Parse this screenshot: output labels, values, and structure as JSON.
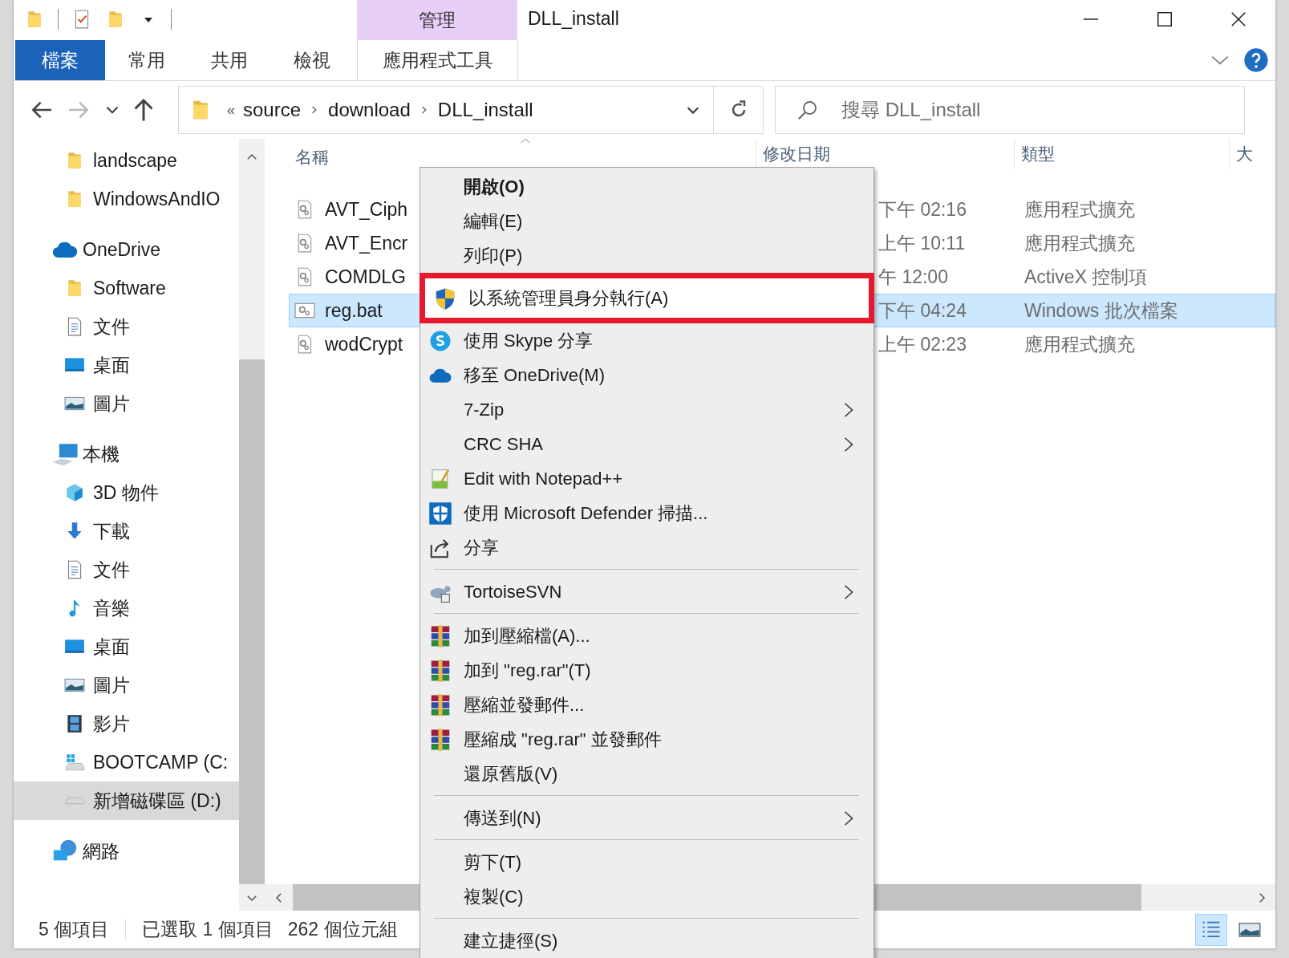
{
  "title_bar": {
    "context_group": "管理",
    "title": "DLL_install"
  },
  "ribbon": {
    "tabs": [
      {
        "label": "檔案",
        "kind": "file"
      },
      {
        "label": "常用",
        "kind": "normal"
      },
      {
        "label": "共用",
        "kind": "normal"
      },
      {
        "label": "檢視",
        "kind": "normal"
      },
      {
        "label": "應用程式工具",
        "kind": "contextual"
      }
    ]
  },
  "address_bar": {
    "overflow_mark": "«",
    "crumbs": [
      "source",
      "download",
      "DLL_install"
    ]
  },
  "search": {
    "placeholder": "搜尋 DLL_install"
  },
  "nav": {
    "sections": [
      {
        "children": [
          {
            "label": "landscape",
            "kind": "folder",
            "selected": false
          },
          {
            "label": "WindowsAndIO",
            "kind": "folder",
            "selected": false
          }
        ]
      },
      {
        "label": "OneDrive",
        "kind": "cloud",
        "selected": false,
        "children": [
          {
            "label": "Software",
            "kind": "folder",
            "selected": false
          },
          {
            "label": "文件",
            "kind": "document",
            "selected": false
          },
          {
            "label": "桌面",
            "kind": "desktop",
            "selected": false
          },
          {
            "label": "圖片",
            "kind": "pictures",
            "selected": false
          }
        ]
      },
      {
        "label": "本機",
        "kind": "computer",
        "selected": false,
        "children": [
          {
            "label": "3D 物件",
            "kind": "cube",
            "selected": false
          },
          {
            "label": "下載",
            "kind": "download",
            "selected": false
          },
          {
            "label": "文件",
            "kind": "document",
            "selected": false
          },
          {
            "label": "音樂",
            "kind": "music",
            "selected": false
          },
          {
            "label": "桌面",
            "kind": "desktop",
            "selected": false
          },
          {
            "label": "圖片",
            "kind": "pictures",
            "selected": false
          },
          {
            "label": "影片",
            "kind": "video",
            "selected": false
          },
          {
            "label": "BOOTCAMP (C:",
            "kind": "windows-drive",
            "selected": false
          },
          {
            "label": "新增磁碟區 (D:)",
            "kind": "drive",
            "selected": true
          }
        ]
      },
      {
        "label": "網路",
        "kind": "network",
        "selected": false
      }
    ]
  },
  "file_list": {
    "columns": [
      "名稱",
      "修改日期",
      "類型",
      "大"
    ],
    "rows": [
      {
        "name": "AVT_Ciph",
        "kind": "library",
        "modified": "下午 02:16",
        "type": "應用程式擴充",
        "selected": false
      },
      {
        "name": "AVT_Encr",
        "kind": "library",
        "modified": "上午 10:11",
        "type": "應用程式擴充",
        "selected": false
      },
      {
        "name": "COMDLG",
        "kind": "library",
        "modified": "午 12:00",
        "type": "ActiveX 控制項",
        "selected": false
      },
      {
        "name": "reg.bat",
        "kind": "batch",
        "modified": "下午 04:24",
        "type": "Windows 批次檔案",
        "selected": true
      },
      {
        "name": "wodCrypt",
        "kind": "library",
        "modified": "上午 02:23",
        "type": "應用程式擴充",
        "selected": false
      }
    ]
  },
  "context_menu": {
    "items": [
      {
        "kind": "plain",
        "label": "開啟(O)",
        "bold": true,
        "submenu": false,
        "highlighted": false
      },
      {
        "kind": "plain",
        "label": "編輯(E)",
        "bold": false,
        "submenu": false,
        "highlighted": false
      },
      {
        "kind": "plain",
        "label": "列印(P)",
        "bold": false,
        "submenu": false,
        "highlighted": false
      },
      {
        "kind": "shield",
        "label": "以系統管理員身分執行(A)",
        "bold": false,
        "submenu": false,
        "highlighted": true
      },
      {
        "kind": "skype",
        "label": "使用 Skype 分享",
        "bold": false,
        "submenu": false,
        "highlighted": false
      },
      {
        "kind": "cloud",
        "label": "移至 OneDrive(M)",
        "bold": false,
        "submenu": false,
        "highlighted": false
      },
      {
        "kind": "plain",
        "label": "7-Zip",
        "bold": false,
        "submenu": true,
        "highlighted": false
      },
      {
        "kind": "plain",
        "label": "CRC SHA",
        "bold": false,
        "submenu": true,
        "highlighted": false
      },
      {
        "kind": "notepad",
        "label": "Edit with Notepad++",
        "bold": false,
        "submenu": false,
        "highlighted": false
      },
      {
        "kind": "defender",
        "label": "使用 Microsoft Defender 掃描...",
        "bold": false,
        "submenu": false,
        "highlighted": false
      },
      {
        "kind": "share",
        "label": "分享",
        "bold": false,
        "submenu": false,
        "highlighted": false
      },
      {
        "kind": "separator"
      },
      {
        "kind": "turtle",
        "label": "TortoiseSVN",
        "bold": false,
        "submenu": true,
        "highlighted": false
      },
      {
        "kind": "separator"
      },
      {
        "kind": "archive",
        "label": "加到壓縮檔(A)...",
        "bold": false,
        "submenu": false,
        "highlighted": false
      },
      {
        "kind": "archive",
        "label": "加到 \"reg.rar\"(T)",
        "bold": false,
        "submenu": false,
        "highlighted": false
      },
      {
        "kind": "archive",
        "label": "壓縮並發郵件...",
        "bold": false,
        "submenu": false,
        "highlighted": false
      },
      {
        "kind": "archive",
        "label": "壓縮成 \"reg.rar\" 並發郵件",
        "bold": false,
        "submenu": false,
        "highlighted": false
      },
      {
        "kind": "plain",
        "label": "還原舊版(V)",
        "bold": false,
        "submenu": false,
        "highlighted": false
      },
      {
        "kind": "separator"
      },
      {
        "kind": "plain",
        "label": "傳送到(N)",
        "bold": false,
        "submenu": true,
        "highlighted": false
      },
      {
        "kind": "separator"
      },
      {
        "kind": "plain",
        "label": "剪下(T)",
        "bold": false,
        "submenu": false,
        "highlighted": false
      },
      {
        "kind": "plain",
        "label": "複製(C)",
        "bold": false,
        "submenu": false,
        "highlighted": false
      },
      {
        "kind": "separator"
      },
      {
        "kind": "plain",
        "label": "建立捷徑(S)",
        "bold": false,
        "submenu": false,
        "highlighted": false
      }
    ]
  },
  "status_bar": {
    "item_count": "5 個項目",
    "selection": "已選取 1 個項目",
    "size": "262 個位元組",
    "view_buttons": [
      {
        "kind": "details",
        "selected": true
      },
      {
        "kind": "large-icons",
        "selected": false
      }
    ]
  }
}
